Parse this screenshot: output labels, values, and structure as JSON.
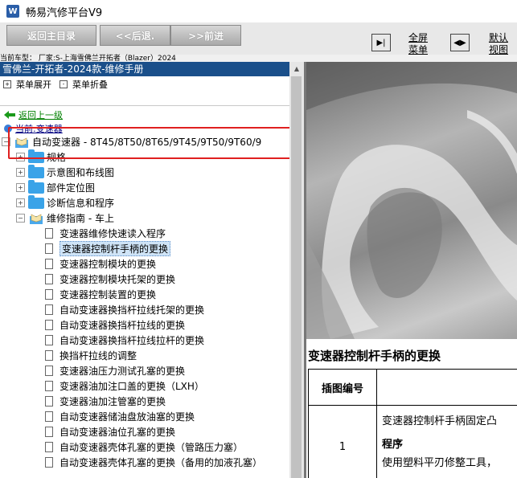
{
  "window": {
    "title": "畅易汽修平台V9",
    "icon": "app-logo-icon"
  },
  "toolbar": {
    "back_main": "返回主目录",
    "back": "<<后退.",
    "forward": ">>前进",
    "fullscreen_line1": "全屏",
    "fullscreen_line2": "菜单",
    "default_line1": "默认",
    "default_line2": "视图"
  },
  "vehicle": "当前车型：  厂家:S-上海雪佛兰开拓者（Blazer）2024",
  "manual": {
    "header": "雪佛兰-开拓者-2024款-维修手册",
    "expand_menu": "菜单展开",
    "collapse_menu": "菜单折叠",
    "back_one_level": "返回上一级",
    "current": "当前:变速器"
  },
  "tree": {
    "root": "自动变速器 - 8T45/8T50/8T65/9T45/9T50/9T60/9",
    "folders": [
      "规格",
      "示意图和布线图",
      "部件定位图",
      "诊断信息和程序"
    ],
    "open_folder": "维修指南 - 车上",
    "items": [
      "变速器维修快速读入程序",
      "变速器控制杆手柄的更换",
      "变速器控制模块的更换",
      "变速器控制模块托架的更换",
      "变速器控制装置的更换",
      "自动变速器换挡杆拉线托架的更换",
      "自动变速器换挡杆拉线的更换",
      "自动变速器换挡杆拉线拉杆的更换",
      "换挡杆拉线的调整",
      "变速器油压力测试孔塞的更换",
      "变速器油加注口盖的更换（LXH）",
      "变速器油加注管塞的更换",
      "自动变速器储油盘放油塞的更换",
      "自动变速器油位孔塞的更换",
      "自动变速器壳体孔塞的更换（管路压力塞）",
      "自动变速器壳体孔塞的更换（备用的加液孔塞）"
    ]
  },
  "document": {
    "title": "变速器控制杆手柄的更换",
    "table_header": "插图编号",
    "row_number": "1",
    "row_text": "变速器控制杆手柄固定凸",
    "procedure_label": "程序",
    "procedure_text": "使用塑料平刃修整工具，"
  }
}
